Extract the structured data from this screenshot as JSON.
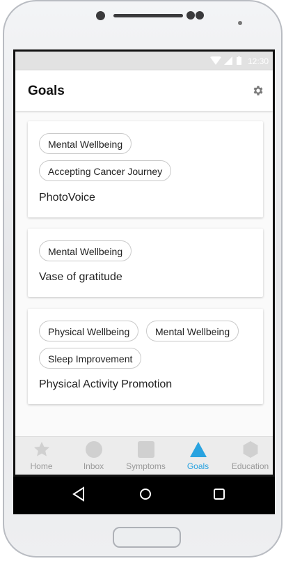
{
  "status_bar": {
    "time": "12:30"
  },
  "app_bar": {
    "title": "Goals",
    "settings_icon": "gear-icon"
  },
  "goals": [
    {
      "tags": [
        "Mental Wellbeing",
        "Accepting Cancer Journey"
      ],
      "title": "PhotoVoice"
    },
    {
      "tags": [
        "Mental Wellbeing"
      ],
      "title": "Vase of gratitude"
    },
    {
      "tags": [
        "Physical Wellbeing",
        "Mental Wellbeing",
        "Sleep Improvement"
      ],
      "title": "Physical Activity Promotion"
    }
  ],
  "bottom_nav": {
    "items": [
      {
        "label": "Home",
        "icon": "star-icon"
      },
      {
        "label": "Inbox",
        "icon": "circle-icon"
      },
      {
        "label": "Symptoms",
        "icon": "square-icon"
      },
      {
        "label": "Goals",
        "icon": "triangle-icon"
      },
      {
        "label": "Education",
        "icon": "hexagon-icon"
      }
    ],
    "active_index": 3
  },
  "system_nav": {
    "icons": [
      "back-icon",
      "home-icon",
      "recents-icon"
    ]
  },
  "colors": {
    "accent": "#29a3e0",
    "inactive_icon": "#d0d0d0"
  }
}
